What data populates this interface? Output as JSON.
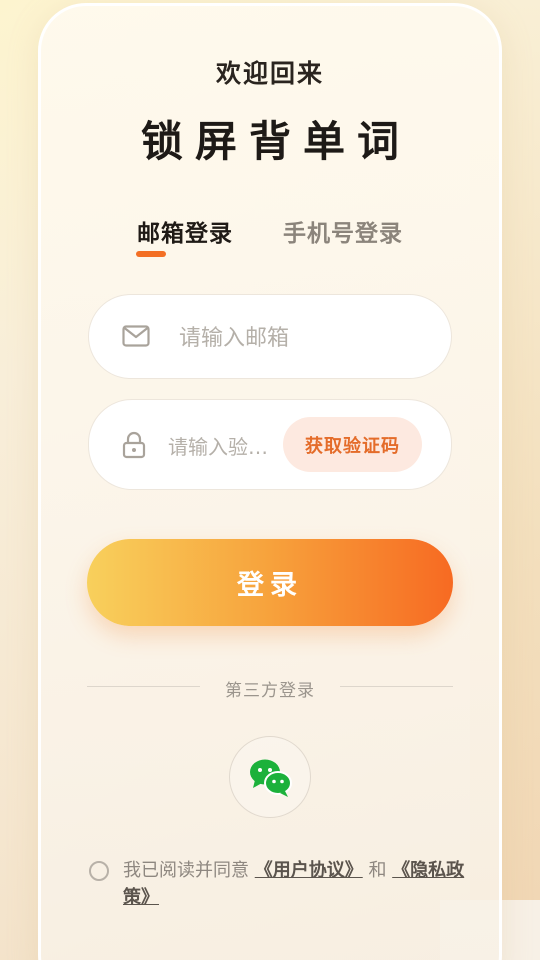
{
  "header": {
    "welcome": "欢迎回来",
    "app_title": "锁屏背单词"
  },
  "tabs": [
    {
      "label": "邮箱登录",
      "active": true
    },
    {
      "label": "手机号登录",
      "active": false
    }
  ],
  "form": {
    "email_placeholder": "请输入邮箱",
    "email_icon": "mail-icon",
    "code_placeholder": "请输入验证码",
    "code_placeholder_display": "请输入验…",
    "code_icon": "lock-icon",
    "get_code_label": "获取验证码",
    "login_label": "登录"
  },
  "third_party": {
    "label": "第三方登录",
    "wechat_icon": "wechat-icon"
  },
  "agreement": {
    "prefix": "我已阅读并同意 ",
    "user_agreement": "《用户协议》",
    "and": " 和 ",
    "privacy_policy": "《隐私政策》"
  },
  "colors": {
    "accent": "#f36f24",
    "gradient_start": "#f8d05c",
    "gradient_end": "#f76a22",
    "wechat_green": "#1aad19"
  }
}
